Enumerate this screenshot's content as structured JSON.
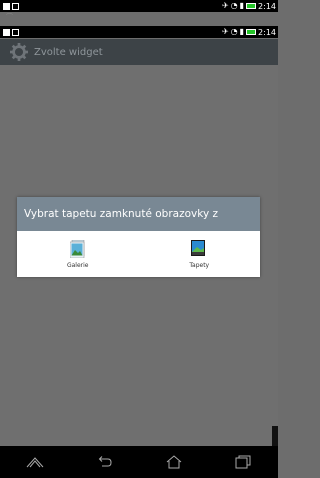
{
  "status_bar": {
    "time": "2:14",
    "battery_color": "#26c52a"
  },
  "header": {
    "title": "Zvolte widget",
    "icon": "gear-icon"
  },
  "dialog": {
    "title": "Vybrat tapetu zamknuté obrazovky z",
    "options": [
      {
        "label": "Galerie",
        "icon": "gallery-icon"
      },
      {
        "label": "Tapety",
        "icon": "wallpaper-icon"
      }
    ]
  },
  "nav": {
    "buttons": [
      "apps-icon",
      "back-icon",
      "home-icon",
      "recents-icon"
    ]
  }
}
